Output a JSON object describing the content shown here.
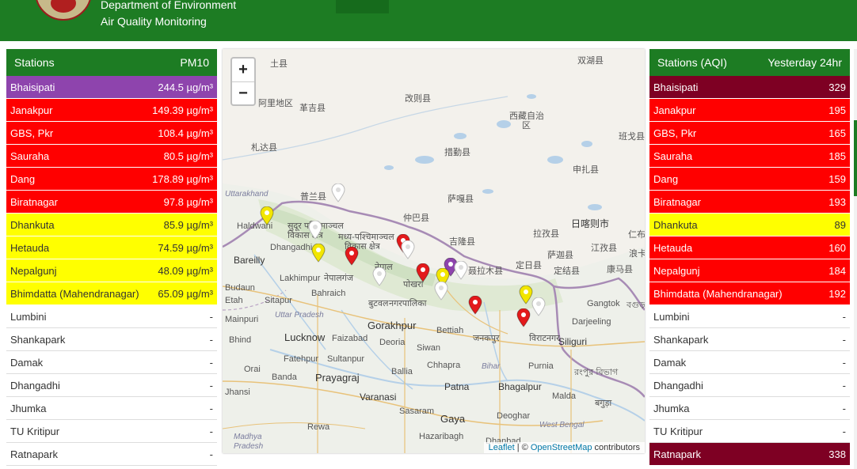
{
  "header": {
    "line1": "Department of Environment",
    "line2": "Air Quality Monitoring"
  },
  "left_table": {
    "header_station": "Stations",
    "header_metric": "PM10",
    "rows": [
      {
        "name": "Bhaisipati",
        "value": "244.5 µg/m³",
        "bg": "#8e44ad",
        "fg": "#ffffff"
      },
      {
        "name": "Janakpur",
        "value": "149.39 µg/m³",
        "bg": "#ff0000",
        "fg": "#ffffff"
      },
      {
        "name": "GBS, Pkr",
        "value": "108.4 µg/m³",
        "bg": "#ff0000",
        "fg": "#ffffff"
      },
      {
        "name": "Sauraha",
        "value": "80.5 µg/m³",
        "bg": "#ff0000",
        "fg": "#ffffff"
      },
      {
        "name": "Dang",
        "value": "178.89 µg/m³",
        "bg": "#ff0000",
        "fg": "#ffffff"
      },
      {
        "name": "Biratnagar",
        "value": "97.8 µg/m³",
        "bg": "#ff0000",
        "fg": "#ffffff"
      },
      {
        "name": "Dhankuta",
        "value": "85.9 µg/m³",
        "bg": "#ffff00",
        "fg": "#333333"
      },
      {
        "name": "Hetauda",
        "value": "74.59 µg/m³",
        "bg": "#ffff00",
        "fg": "#333333"
      },
      {
        "name": "Nepalgunj",
        "value": "48.09 µg/m³",
        "bg": "#ffff00",
        "fg": "#333333"
      },
      {
        "name": "Bhimdatta (Mahendranagar)",
        "value": "65.09 µg/m³",
        "bg": "#ffff00",
        "fg": "#333333"
      },
      {
        "name": "Lumbini",
        "value": "-",
        "bg": "#ffffff",
        "fg": "#333333"
      },
      {
        "name": "Shankapark",
        "value": "-",
        "bg": "#ffffff",
        "fg": "#333333"
      },
      {
        "name": "Damak",
        "value": "-",
        "bg": "#ffffff",
        "fg": "#333333"
      },
      {
        "name": "Dhangadhi",
        "value": "-",
        "bg": "#ffffff",
        "fg": "#333333"
      },
      {
        "name": "Jhumka",
        "value": "-",
        "bg": "#ffffff",
        "fg": "#333333"
      },
      {
        "name": "TU Kritipur",
        "value": "-",
        "bg": "#ffffff",
        "fg": "#333333"
      },
      {
        "name": "Ratnapark",
        "value": "-",
        "bg": "#ffffff",
        "fg": "#333333"
      }
    ]
  },
  "right_table": {
    "header_station": "Stations (AQI)",
    "header_metric": "Yesterday 24hr",
    "rows": [
      {
        "name": "Bhaisipati",
        "value": "329",
        "bg": "#7e0023",
        "fg": "#ffffff"
      },
      {
        "name": "Janakpur",
        "value": "195",
        "bg": "#ff0000",
        "fg": "#ffffff"
      },
      {
        "name": "GBS, Pkr",
        "value": "165",
        "bg": "#ff0000",
        "fg": "#ffffff"
      },
      {
        "name": "Sauraha",
        "value": "185",
        "bg": "#ff0000",
        "fg": "#ffffff"
      },
      {
        "name": "Dang",
        "value": "159",
        "bg": "#ff0000",
        "fg": "#ffffff"
      },
      {
        "name": "Biratnagar",
        "value": "193",
        "bg": "#ff0000",
        "fg": "#ffffff"
      },
      {
        "name": "Dhankuta",
        "value": "89",
        "bg": "#ffff00",
        "fg": "#333333"
      },
      {
        "name": "Hetauda",
        "value": "160",
        "bg": "#ff0000",
        "fg": "#ffffff"
      },
      {
        "name": "Nepalgunj",
        "value": "184",
        "bg": "#ff0000",
        "fg": "#ffffff"
      },
      {
        "name": "Bhimdatta (Mahendranagar)",
        "value": "192",
        "bg": "#ff0000",
        "fg": "#ffffff"
      },
      {
        "name": "Lumbini",
        "value": "-",
        "bg": "#ffffff",
        "fg": "#333333"
      },
      {
        "name": "Shankapark",
        "value": "-",
        "bg": "#ffffff",
        "fg": "#333333"
      },
      {
        "name": "Damak",
        "value": "-",
        "bg": "#ffffff",
        "fg": "#333333"
      },
      {
        "name": "Dhangadhi",
        "value": "-",
        "bg": "#ffffff",
        "fg": "#333333"
      },
      {
        "name": "Jhumka",
        "value": "-",
        "bg": "#ffffff",
        "fg": "#333333"
      },
      {
        "name": "TU Kritipur",
        "value": "-",
        "bg": "#ffffff",
        "fg": "#333333"
      },
      {
        "name": "Ratnapark",
        "value": "338",
        "bg": "#7e0023",
        "fg": "#ffffff"
      }
    ]
  },
  "map": {
    "zoom_in": "+",
    "zoom_out": "−",
    "attribution_leaflet": "Leaflet",
    "attribution_sep": " | © ",
    "attribution_osm": "OpenStreetMap",
    "attribution_tail": " contributors",
    "labels": {
      "l01": "土县",
      "l02": "双湖县",
      "l03": "阿里地区",
      "l04": "革吉县",
      "l05": "改则县",
      "l06": "西藏自治",
      "l07": "区",
      "l08": "班戈县",
      "l09": "札达县",
      "l10": "措勤县",
      "l11": "申扎县",
      "l12": "Uttarakhand",
      "l13": "普兰县",
      "l14": "仲巴县",
      "l15": "萨嘎县",
      "l16": "日喀则市",
      "l17": "Haldwani",
      "l18": "सुदूर पश्चिमाञ्चल",
      "l19": "विकास क्षेत्र",
      "l20": "मध्य-पश्चिमाञ्चल",
      "l21": "विकास क्षेत्र",
      "l22": "吉隆县",
      "l23": "拉孜县",
      "l24": "江孜县",
      "l25": "Dhangadhi",
      "l26": "Bareilly",
      "l27": "नेपाल",
      "l28": "定日县",
      "l29": "萨迦县",
      "l30": "康马县",
      "l31": "Lakhimpur",
      "l32": "नेपालगंज",
      "l33": "पोखरा",
      "l34": "聂拉木县",
      "l35": "定结县",
      "l36": "Budaun",
      "l37": "Sitapur",
      "l38": "Bahraich",
      "l39": "बुटवल",
      "l40": "नगरपालिका",
      "l41": "Gangtok",
      "l42": "Etah",
      "l43": "Uttar Pradesh",
      "l44": "Gorakhpur",
      "l45": "Bettiah",
      "l46": "जनकपुर",
      "l47": "विराटनगर",
      "l48": "Darjeeling",
      "l49": "Mainpuri",
      "l50": "Bhind",
      "l51": "Lucknow",
      "l52": "Faizabad",
      "l53": "Deoria",
      "l54": "Siwan",
      "l55": "Siliguri",
      "l56": "Fatehpur",
      "l57": "Sultanpur",
      "l58": "Bihar",
      "l59": "Purnia",
      "l60": "Chhapra",
      "l61": "Orai",
      "l62": "Banda",
      "l63": "Prayagraj",
      "l64": "Ballia",
      "l65": "Patna",
      "l66": "Bhagalpur",
      "l67": "Jhansi",
      "l68": "Varanasi",
      "l69": "Malda",
      "l70": "Sasaram",
      "l71": "Deoghar",
      "l72": "West Bengal",
      "l73": "Rewa",
      "l74": "Gaya",
      "l75": "Madhya",
      "l76": "Pradesh",
      "l77": "Hazaribagh",
      "l78": "Dhanbad",
      "l79": "बगुड़ा",
      "l80": "রংপুর বিভাগ",
      "l81": "仁布",
      "l82": "浪卡",
      "l83": "বগুড়া"
    }
  },
  "colors": {
    "header_green": "#1d7c23",
    "marker_red": "#e31a1c",
    "marker_yellow": "#f2e600",
    "marker_purple": "#8e44ad",
    "marker_white": "#ffffff"
  }
}
